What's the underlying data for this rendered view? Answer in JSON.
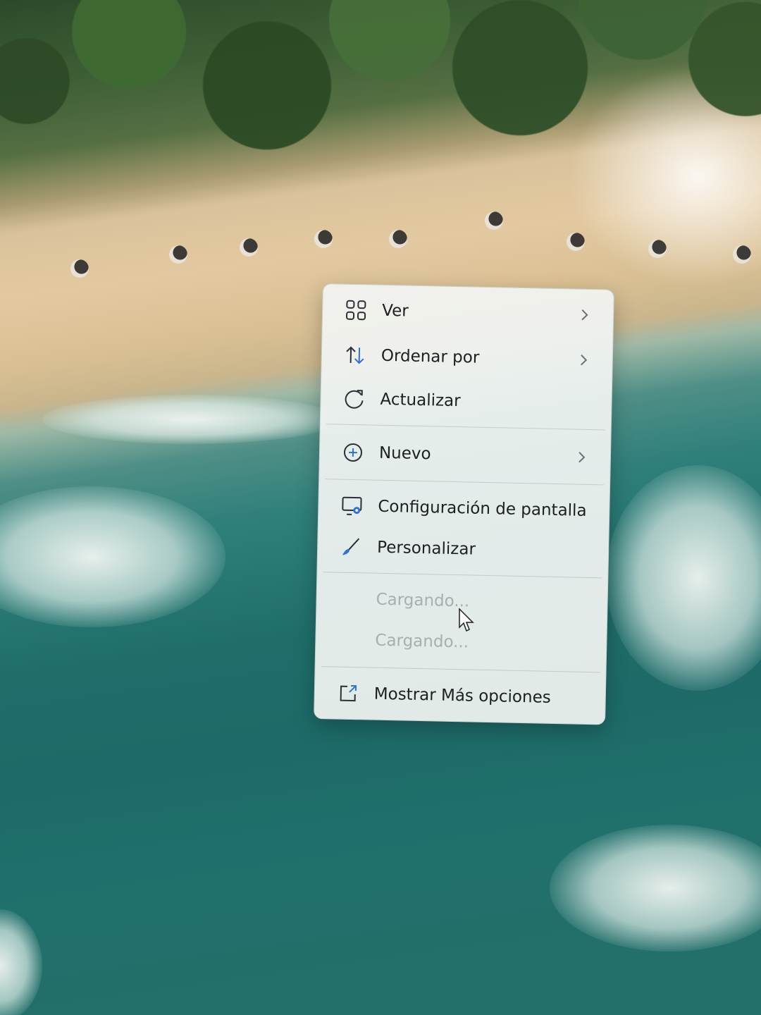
{
  "context_menu": {
    "items": [
      {
        "label": "Ver",
        "icon": "grid-view-icon",
        "has_submenu": true,
        "disabled": false
      },
      {
        "label": "Ordenar por",
        "icon": "sort-arrows-icon",
        "has_submenu": true,
        "disabled": false
      },
      {
        "label": "Actualizar",
        "icon": "refresh-icon",
        "has_submenu": false,
        "disabled": false
      },
      {
        "label": "Nuevo",
        "icon": "plus-circle-icon",
        "has_submenu": true,
        "disabled": false
      },
      {
        "label": "Configuración de pantalla",
        "icon": "display-settings-icon",
        "has_submenu": false,
        "disabled": false
      },
      {
        "label": "Personalizar",
        "icon": "brush-icon",
        "has_submenu": false,
        "disabled": false
      },
      {
        "label": "Cargando...",
        "icon": "",
        "has_submenu": false,
        "disabled": true
      },
      {
        "label": "Cargando...",
        "icon": "",
        "has_submenu": false,
        "disabled": true
      },
      {
        "label": "Mostrar Más opciones",
        "icon": "open-external-icon",
        "has_submenu": false,
        "disabled": false
      }
    ]
  },
  "colors": {
    "menu_background": "#f1f4f2",
    "text": "#1d1f22",
    "disabled_text": "#a9aeb0",
    "accent_blue": "#2f73d6"
  }
}
